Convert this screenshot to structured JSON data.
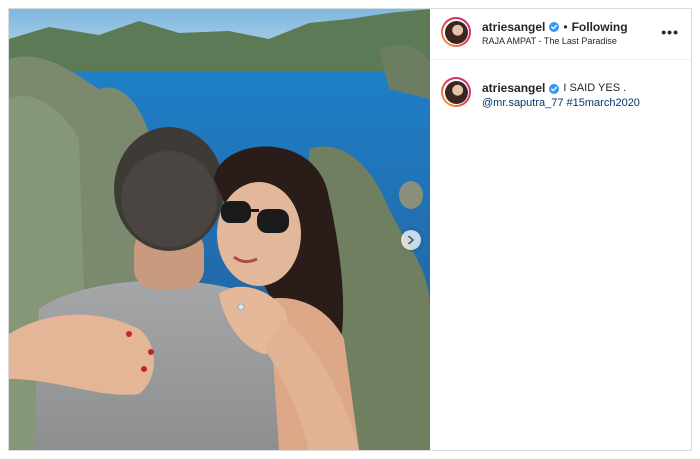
{
  "post": {
    "username": "atriesangel",
    "separator": "•",
    "follow_status": "Following",
    "location": "RAJA AMPAT - The Last Paradise",
    "more_glyph": "•••",
    "caption_text": "I SAID YES .",
    "caption_tags": "@mr.saputra_77 #15march2020"
  },
  "colors": {
    "verified": "#3897f0",
    "link": "#00376b",
    "avatar_ring": "#e8365b"
  },
  "icons": {
    "verified": "verified-badge-icon",
    "next": "chevron-right-icon",
    "more": "more-options-icon"
  }
}
